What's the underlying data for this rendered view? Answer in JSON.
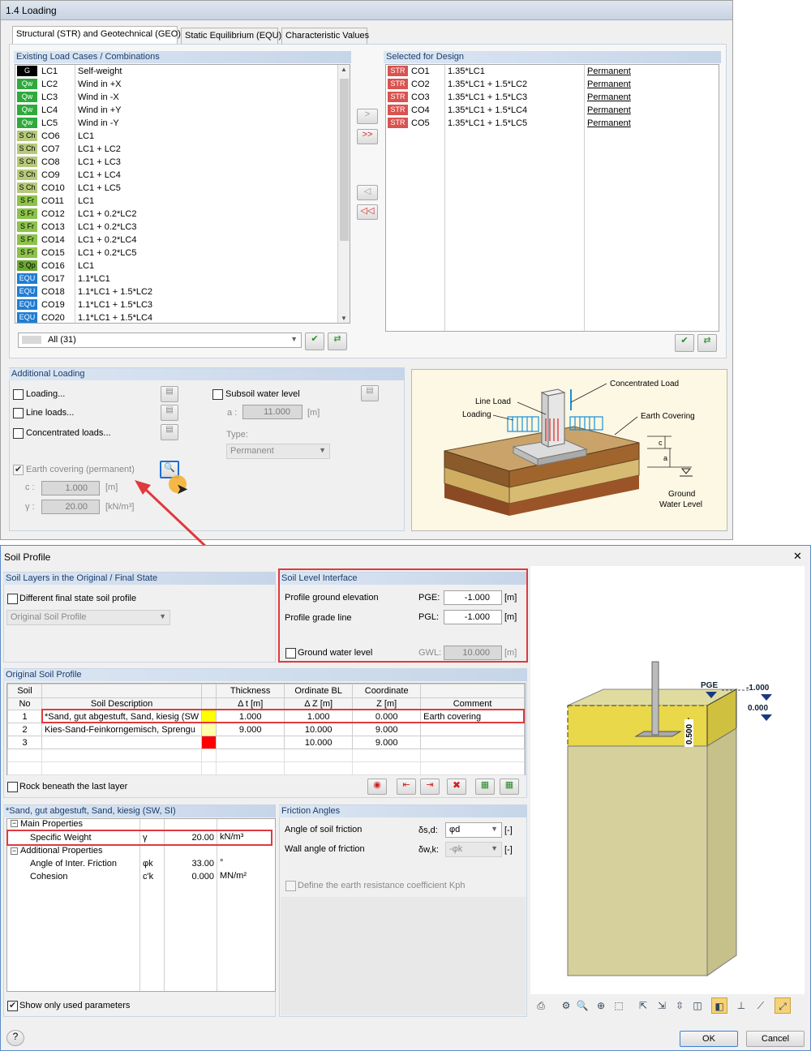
{
  "top": {
    "title": "1.4 Loading",
    "tabs": [
      "Structural (STR) and Geotechnical (GEO)",
      "Static Equilibrium (EQU)",
      "Characteristic Values"
    ],
    "existing_header": "Existing Load Cases / Combinations",
    "selected_header": "Selected for Design",
    "existing_rows": [
      {
        "badge": "G",
        "id": "LC1",
        "desc": "Self-weight",
        "color": "#000000",
        "fg": "#ffffff"
      },
      {
        "badge": "Qw",
        "id": "LC2",
        "desc": "Wind in +X",
        "color": "#2eaa3c",
        "fg": "#ffffff"
      },
      {
        "badge": "Qw",
        "id": "LC3",
        "desc": "Wind in -X",
        "color": "#2eaa3c",
        "fg": "#ffffff"
      },
      {
        "badge": "Qw",
        "id": "LC4",
        "desc": "Wind in +Y",
        "color": "#2eaa3c",
        "fg": "#ffffff"
      },
      {
        "badge": "Qw",
        "id": "LC5",
        "desc": "Wind in -Y",
        "color": "#2eaa3c",
        "fg": "#ffffff"
      },
      {
        "badge": "S Ch",
        "id": "CO6",
        "desc": "LC1",
        "color": "#b6c97a",
        "fg": "#000000"
      },
      {
        "badge": "S Ch",
        "id": "CO7",
        "desc": "LC1 + LC2",
        "color": "#b6c97a",
        "fg": "#000000"
      },
      {
        "badge": "S Ch",
        "id": "CO8",
        "desc": "LC1 + LC3",
        "color": "#b6c97a",
        "fg": "#000000"
      },
      {
        "badge": "S Ch",
        "id": "CO9",
        "desc": "LC1 + LC4",
        "color": "#b6c97a",
        "fg": "#000000"
      },
      {
        "badge": "S Ch",
        "id": "CO10",
        "desc": "LC1 + LC5",
        "color": "#b6c97a",
        "fg": "#000000"
      },
      {
        "badge": "S Fr",
        "id": "CO11",
        "desc": "LC1",
        "color": "#8cc34a",
        "fg": "#000000"
      },
      {
        "badge": "S Fr",
        "id": "CO12",
        "desc": "LC1 + 0.2*LC2",
        "color": "#8cc34a",
        "fg": "#000000"
      },
      {
        "badge": "S Fr",
        "id": "CO13",
        "desc": "LC1 + 0.2*LC3",
        "color": "#8cc34a",
        "fg": "#000000"
      },
      {
        "badge": "S Fr",
        "id": "CO14",
        "desc": "LC1 + 0.2*LC4",
        "color": "#8cc34a",
        "fg": "#000000"
      },
      {
        "badge": "S Fr",
        "id": "CO15",
        "desc": "LC1 + 0.2*LC5",
        "color": "#8cc34a",
        "fg": "#000000"
      },
      {
        "badge": "S Qp",
        "id": "CO16",
        "desc": "LC1",
        "color": "#6aa832",
        "fg": "#000000"
      },
      {
        "badge": "EQU",
        "id": "CO17",
        "desc": "1.1*LC1",
        "color": "#1f7dd4",
        "fg": "#ffffff"
      },
      {
        "badge": "EQU",
        "id": "CO18",
        "desc": "1.1*LC1 + 1.5*LC2",
        "color": "#1f7dd4",
        "fg": "#ffffff"
      },
      {
        "badge": "EQU",
        "id": "CO19",
        "desc": "1.1*LC1 + 1.5*LC3",
        "color": "#1f7dd4",
        "fg": "#ffffff"
      },
      {
        "badge": "EQU",
        "id": "CO20",
        "desc": "1.1*LC1 + 1.5*LC4",
        "color": "#1f7dd4",
        "fg": "#ffffff"
      }
    ],
    "selected_rows": [
      {
        "badge": "STR",
        "id": "CO1",
        "desc": "1.35*LC1",
        "type": "Permanent"
      },
      {
        "badge": "STR",
        "id": "CO2",
        "desc": "1.35*LC1 + 1.5*LC2",
        "type": "Permanent"
      },
      {
        "badge": "STR",
        "id": "CO3",
        "desc": "1.35*LC1 + 1.5*LC3",
        "type": "Permanent"
      },
      {
        "badge": "STR",
        "id": "CO4",
        "desc": "1.35*LC1 + 1.5*LC4",
        "type": "Permanent"
      },
      {
        "badge": "STR",
        "id": "CO5",
        "desc": "1.35*LC1 + 1.5*LC5",
        "type": "Permanent"
      }
    ],
    "filter": "All (31)",
    "move_buttons": [
      ">",
      ">>",
      "◁",
      "◁◁"
    ],
    "additional": {
      "header": "Additional Loading",
      "loading": "Loading...",
      "line_loads": "Line loads...",
      "concentrated": "Concentrated loads...",
      "earth": "Earth covering (permanent)",
      "c_label": "c :",
      "c_value": "1.000",
      "c_unit": "[m]",
      "g_label": "γ :",
      "g_value": "20.00",
      "g_unit": "[kN/m³]",
      "subsoil": "Subsoil water level",
      "a_label": "a :",
      "a_value": "11.000",
      "a_unit": "[m]",
      "type_label": "Type:",
      "type_value": "Permanent"
    },
    "diagram": {
      "concentrated": "Concentrated Load",
      "line_load": "Line Load",
      "loading": "Loading",
      "earth_covering": "Earth Covering",
      "ground_water_1": "Ground",
      "ground_water_2": "Water Level",
      "c": "c",
      "a": "a"
    }
  },
  "dialog": {
    "title": "Soil Profile",
    "close": "✕",
    "layers_header": "Soil Layers in the Original / Final State",
    "diff_final": "Different final state soil profile",
    "profile_dd": "Original Soil Profile",
    "interface_header": "Soil Level Interface",
    "pge_label": "Profile ground elevation",
    "pge_code": "PGE:",
    "pge_value": "-1.000",
    "pge_unit": "[m]",
    "pgl_label": "Profile grade line",
    "pgl_code": "PGL:",
    "pgl_value": "-1.000",
    "pgl_unit": "[m]",
    "gwl_label": "Ground water level",
    "gwl_code": "GWL:",
    "gwl_value": "10.000",
    "gwl_unit": "[m]",
    "profile_header": "Original Soil Profile",
    "col_headers": {
      "no1": "Soil",
      "no2": "No",
      "desc": "Soil Description",
      "t1": "Thickness",
      "t2": "Δ t [m]",
      "o1": "Ordinate BL",
      "o2": "Δ Z [m]",
      "c1": "Coordinate",
      "c2": "Z [m]",
      "comment": "Comment"
    },
    "rows": [
      {
        "no": "1",
        "desc": "*Sand, gut abgestuft, Sand, kiesig (SW",
        "color": "#ffff00",
        "t": "1.000",
        "o": "1.000",
        "z": "0.000",
        "comment": "Earth covering"
      },
      {
        "no": "2",
        "desc": "Kies-Sand-Feinkorngemisch, Sprengu",
        "color": "#ffffaa",
        "t": "9.000",
        "o": "10.000",
        "z": "9.000",
        "comment": ""
      },
      {
        "no": "3",
        "desc": "",
        "color": "#ff0000",
        "t": "",
        "o": "10.000",
        "z": "9.000",
        "comment": ""
      }
    ],
    "rock": "Rock beneath the last layer",
    "props_header": "*Sand, gut abgestuft, Sand, kiesig (SW, SI)",
    "main_props": "Main Properties",
    "specific_weight": "Specific Weight",
    "sw_sym": "γ",
    "sw_val": "20.00",
    "sw_unit": "kN/m³",
    "add_props": "Additional Properties",
    "friction": "Angle of Inter. Friction",
    "fr_sym": "φk",
    "fr_val": "33.00",
    "fr_unit": "°",
    "cohesion": "Cohesion",
    "co_sym": "c'k",
    "co_val": "0.000",
    "co_unit": "MN/m²",
    "show_used": "Show only used parameters",
    "friction_header": "Friction Angles",
    "soil_friction": "Angle of soil friction",
    "sf_sym": "δs,d:",
    "sf_val": "φd",
    "sf_unit": "[-]",
    "wall_friction": "Wall angle of friction",
    "wf_sym": "δw,k:",
    "wf_val": "-φk",
    "wf_unit": "[-]",
    "kph": "Define the earth resistance coefficient Kph",
    "view": {
      "pge": "PGE",
      "v1": "-1.000",
      "v2": "0.000",
      "dim": "0.500"
    },
    "ok": "OK",
    "cancel": "Cancel",
    "help": "?"
  }
}
